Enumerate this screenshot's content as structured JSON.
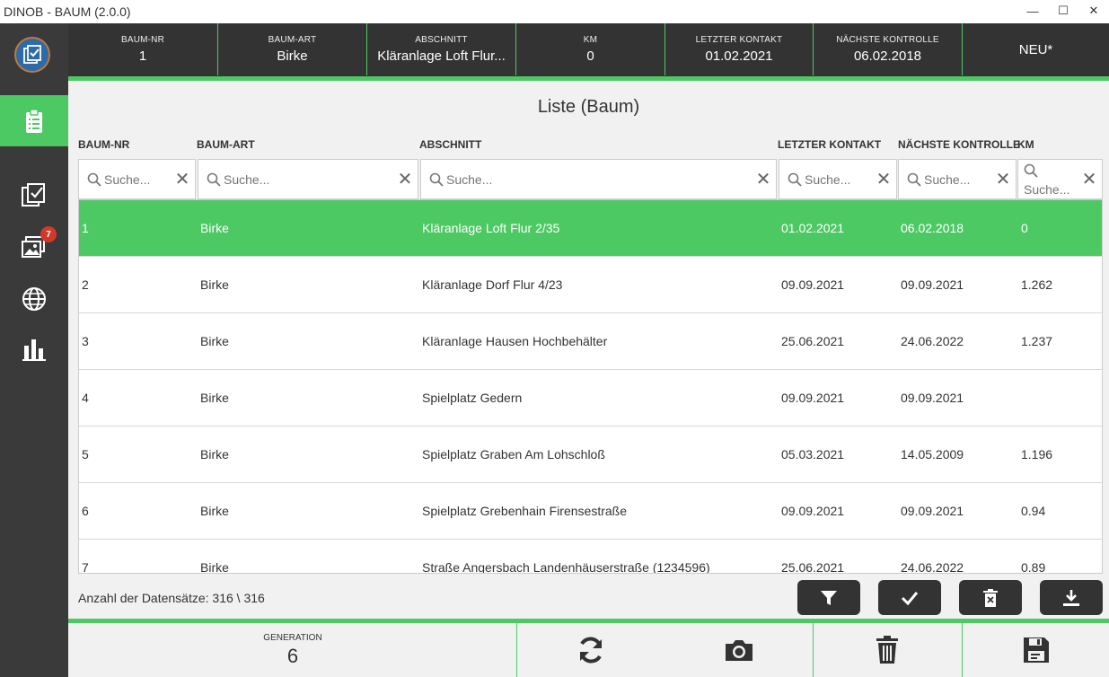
{
  "window": {
    "title": "DINOB - BAUM (2.0.0)",
    "minimize": "—",
    "maximize": "☐",
    "close": "✕"
  },
  "sidebar": {
    "badge_count": "7",
    "icons": [
      "clipboard-list-icon",
      "checklist-icon",
      "photos-icon",
      "globe-icon",
      "bar-chart-icon"
    ]
  },
  "header": {
    "baum_nr": {
      "label": "BAUM-NR",
      "value": "1"
    },
    "baum_art": {
      "label": "BAUM-ART",
      "value": "Birke"
    },
    "abschnitt": {
      "label": "ABSCHNITT",
      "value": "Kläranlage Loft  Flur..."
    },
    "km": {
      "label": "KM",
      "value": "0"
    },
    "letzter_kontakt": {
      "label": "LETZTER KONTAKT",
      "value": "01.02.2021"
    },
    "naechste_kontrolle": {
      "label": "NÄCHSTE KONTROLLE",
      "value": "06.02.2018"
    },
    "neu": "NEU*"
  },
  "list": {
    "title": "Liste (Baum)",
    "columns": {
      "baum_nr": "BAUM-NR",
      "baum_art": "BAUM-ART",
      "abschnitt": "ABSCHNITT",
      "letzter_kontakt": "LETZTER KONTAKT",
      "naechste_kontrolle": "NÄCHSTE KONTROLLE",
      "km": "KM"
    },
    "search_placeholder": "Suche...",
    "clear": "✕",
    "rows": [
      {
        "nr": "1",
        "art": "Birke",
        "abschnitt": "Kläranlage Loft  Flur 2/35",
        "letzter": "01.02.2021",
        "naechste": "06.02.2018",
        "km": "0"
      },
      {
        "nr": "2",
        "art": "Birke",
        "abschnitt": "Kläranlage Dorf  Flur 4/23",
        "letzter": "09.09.2021",
        "naechste": "09.09.2021",
        "km": "1.262"
      },
      {
        "nr": "3",
        "art": "Birke",
        "abschnitt": "Kläranlage Hausen  Hochbehälter",
        "letzter": "25.06.2021",
        "naechste": "24.06.2022",
        "km": "1.237"
      },
      {
        "nr": "4",
        "art": "Birke",
        "abschnitt": "Spielplatz Gedern",
        "letzter": "09.09.2021",
        "naechste": "09.09.2021",
        "km": ""
      },
      {
        "nr": "5",
        "art": "Birke",
        "abschnitt": "Spielplatz Graben  Am Lohschloß",
        "letzter": "05.03.2021",
        "naechste": "14.05.2009",
        "km": "1.196"
      },
      {
        "nr": "6",
        "art": "Birke",
        "abschnitt": "Spielplatz Grebenhain  Firensestraße",
        "letzter": "09.09.2021",
        "naechste": "09.09.2021",
        "km": "0.94"
      },
      {
        "nr": "7",
        "art": "Birke",
        "abschnitt": "Straße Angersbach  Landenhäuserstraße (1234596)",
        "letzter": "25.06.2021",
        "naechste": "24.06.2022",
        "km": "0.89"
      }
    ],
    "record_count": "Anzahl der Datensätze: 316 \\ 316"
  },
  "footer": {
    "generation": {
      "label": "GENERATION",
      "value": "6"
    }
  },
  "colors": {
    "accent": "#4cc963",
    "dark": "#333333",
    "sidebar": "#3a3a3a",
    "badge": "#d0392b"
  }
}
